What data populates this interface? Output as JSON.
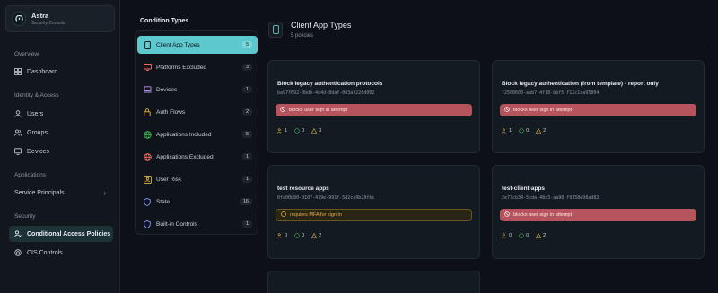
{
  "brand": {
    "name": "Astra",
    "subtitle": "Security Console"
  },
  "sidebar": {
    "sections": [
      {
        "label": "Overview",
        "items": [
          {
            "label": "Dashboard",
            "icon": "grid-icon"
          }
        ]
      },
      {
        "label": "Identity & Access",
        "items": [
          {
            "label": "Users",
            "icon": "user-icon"
          },
          {
            "label": "Groups",
            "icon": "users-icon"
          },
          {
            "label": "Devices",
            "icon": "device-icon"
          }
        ]
      },
      {
        "label": "Applications",
        "items": [
          {
            "label": "Service Principals",
            "icon": "chevron-right-icon"
          }
        ]
      },
      {
        "label": "Security",
        "items": [
          {
            "label": "Conditional Access Policies",
            "icon": "policy-icon",
            "active": true
          },
          {
            "label": "CIS Controls",
            "icon": "shield-check-icon"
          }
        ]
      }
    ]
  },
  "conditions": {
    "title": "Condition Types",
    "items": [
      {
        "label": "Client App Types",
        "count": "5",
        "icon": "phone-icon",
        "active": true
      },
      {
        "label": "Platforms Excluded",
        "count": "3",
        "icon": "monitor-icon"
      },
      {
        "label": "Devices",
        "count": "1",
        "icon": "laptop-icon"
      },
      {
        "label": "Auth Flows",
        "count": "2",
        "icon": "lock-icon"
      },
      {
        "label": "Applications Included",
        "count": "5",
        "icon": "globe-icon"
      },
      {
        "label": "Applications Excluded",
        "count": "1",
        "icon": "globe-icon"
      },
      {
        "label": "User Risk",
        "count": "1",
        "icon": "user-risk-icon"
      },
      {
        "label": "State",
        "count": "16",
        "icon": "shield-icon"
      },
      {
        "label": "Built-in Controls",
        "count": "1",
        "icon": "shield-icon"
      }
    ]
  },
  "main": {
    "title": "Client App Types",
    "subtitle": "5 policies"
  },
  "cards": [
    {
      "title": "Block legacy authentication protocols",
      "id": "ba97f692-0bdb-4d4d-8daf-083af226d002",
      "badge": "blocks user sign in attempt",
      "badge_type": "block",
      "users": "1",
      "groups": "0",
      "warnings": "3"
    },
    {
      "title": "Block legacy authentication (from template) - report only",
      "id": "f2508600-aab7-4f18-bbf5-f12c1ca95004",
      "badge": "blocks user sign in attempt",
      "badge_type": "block",
      "users": "1",
      "groups": "0",
      "warnings": "2"
    },
    {
      "title": "test resource apps",
      "id": "0fa00b80-d107-479e-991f-5d2cc9b29fbc",
      "badge": "requires MFA for sign in",
      "badge_type": "mfa",
      "users": "0",
      "groups": "0",
      "warnings": "2"
    },
    {
      "title": "test-client-apps",
      "id": "2e77cb34-5cda-48c3-aa98-f9158e98ad82",
      "badge": "blocks user sign in attempt",
      "badge_type": "block",
      "users": "0",
      "groups": "0",
      "warnings": "2"
    }
  ],
  "colors": {
    "accent": "#5ec8cf",
    "block": "#b5545d",
    "mfa": "#e3b341",
    "background": "#0d1117"
  }
}
